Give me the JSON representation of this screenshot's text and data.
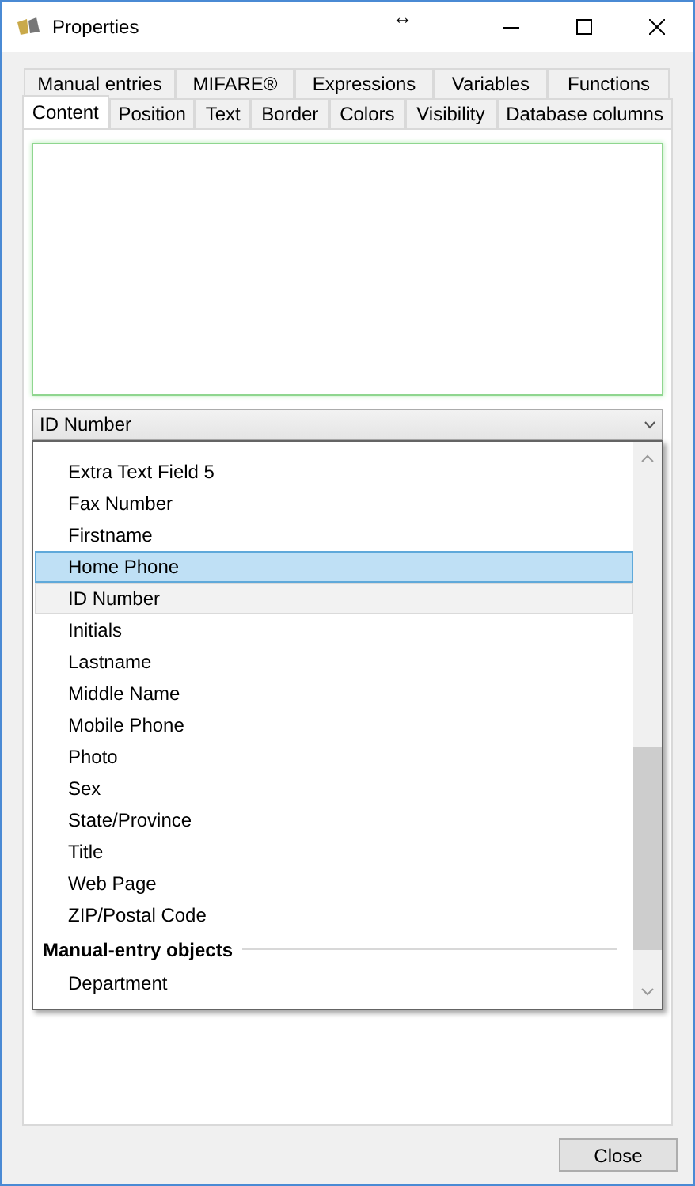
{
  "window": {
    "title": "Properties",
    "resize_glyph": "↔"
  },
  "tabs_row_1": [
    {
      "label": "Manual entries",
      "selected": false
    },
    {
      "label": "MIFARE®",
      "selected": false
    },
    {
      "label": "Expressions",
      "selected": false
    },
    {
      "label": "Variables",
      "selected": false
    },
    {
      "label": "Functions",
      "selected": false
    }
  ],
  "tabs_row_2": [
    {
      "label": "Content",
      "selected": true
    },
    {
      "label": "Position",
      "selected": false
    },
    {
      "label": "Text",
      "selected": false
    },
    {
      "label": "Border",
      "selected": false
    },
    {
      "label": "Colors",
      "selected": false
    },
    {
      "label": "Visibility",
      "selected": false
    },
    {
      "label": "Database columns",
      "selected": false
    }
  ],
  "dropdown": {
    "value": "ID Number"
  },
  "dropdown_list": [
    {
      "kind": "item",
      "label": "Extra Text Field 5",
      "selected": false,
      "current": false
    },
    {
      "kind": "item",
      "label": "Fax Number",
      "selected": false,
      "current": false
    },
    {
      "kind": "item",
      "label": "Firstname",
      "selected": false,
      "current": false
    },
    {
      "kind": "item",
      "label": "Home Phone",
      "selected": true,
      "current": false
    },
    {
      "kind": "item",
      "label": "ID Number",
      "selected": false,
      "current": true
    },
    {
      "kind": "item",
      "label": "Initials",
      "selected": false,
      "current": false
    },
    {
      "kind": "item",
      "label": "Lastname",
      "selected": false,
      "current": false
    },
    {
      "kind": "item",
      "label": "Middle Name",
      "selected": false,
      "current": false
    },
    {
      "kind": "item",
      "label": "Mobile Phone",
      "selected": false,
      "current": false
    },
    {
      "kind": "item",
      "label": "Photo",
      "selected": false,
      "current": false
    },
    {
      "kind": "item",
      "label": "Sex",
      "selected": false,
      "current": false
    },
    {
      "kind": "item",
      "label": "State/Province",
      "selected": false,
      "current": false
    },
    {
      "kind": "item",
      "label": "Title",
      "selected": false,
      "current": false
    },
    {
      "kind": "item",
      "label": "Web Page",
      "selected": false,
      "current": false
    },
    {
      "kind": "item",
      "label": "ZIP/Postal Code",
      "selected": false,
      "current": false
    },
    {
      "kind": "group",
      "label": "Manual-entry objects"
    },
    {
      "kind": "item",
      "label": "Department",
      "selected": false,
      "current": false
    }
  ],
  "buttons": [
    "Close"
  ]
}
